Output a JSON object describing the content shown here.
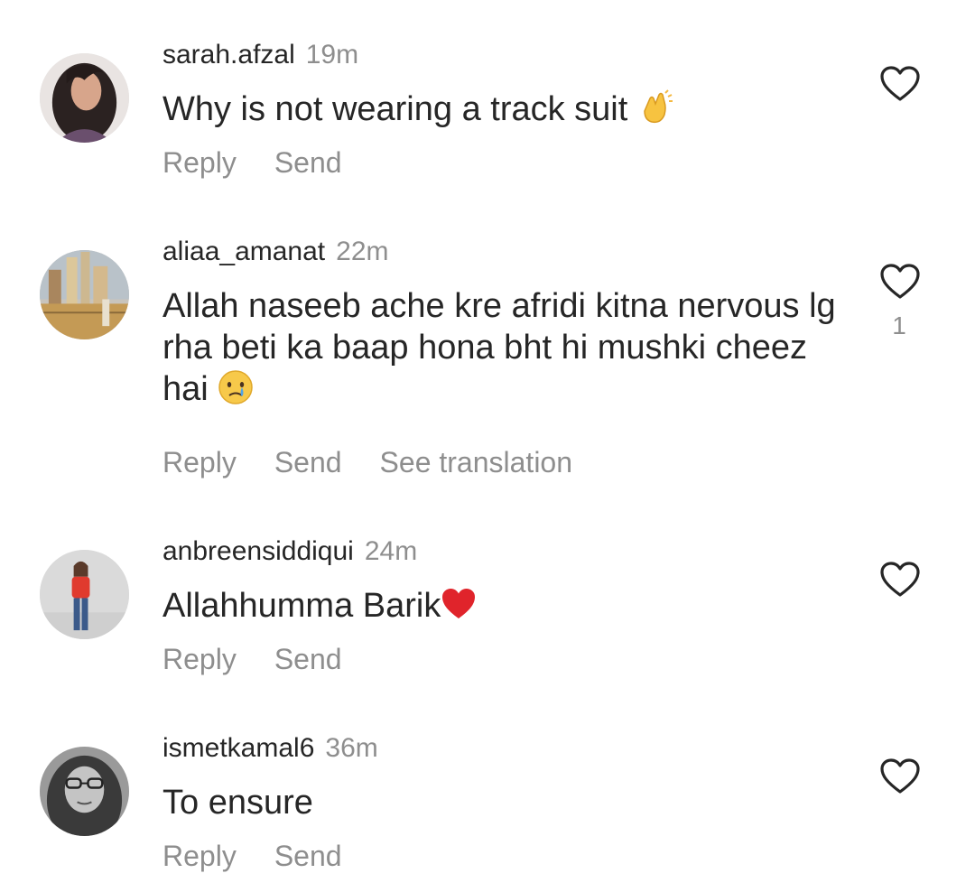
{
  "comments": [
    {
      "username": "sarah.afzal",
      "time": "19m",
      "text": "Why is not wearing a track suit ",
      "emoji": "clapping-hands",
      "actions": [
        "Reply",
        "Send"
      ],
      "likes": ""
    },
    {
      "username": "aliaa_amanat",
      "time": "22m",
      "text": "Allah naseeb ache kre afridi kitna nervous lg rha beti ka baap hona bht hi mushki cheez hai ",
      "emoji": "crying-face",
      "actions": [
        "Reply",
        "Send",
        "See translation"
      ],
      "likes": "1"
    },
    {
      "username": "anbreensiddiqui",
      "time": "24m",
      "text": "Allahhumma Barik",
      "emoji": "red-heart",
      "actions": [
        "Reply",
        "Send"
      ],
      "likes": ""
    },
    {
      "username": "ismetkamal6",
      "time": "36m",
      "text": "To ensure",
      "emoji": "",
      "actions": [
        "Reply",
        "Send"
      ],
      "likes": ""
    }
  ],
  "colors": {
    "text": "#262626",
    "secondary": "#8e8e8e"
  }
}
